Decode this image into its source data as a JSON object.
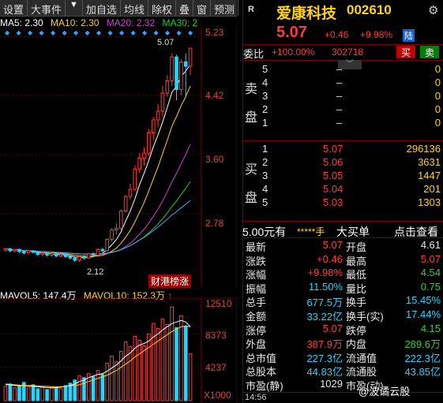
{
  "toolbar": {
    "items": [
      "设置",
      "大事件",
      "▼",
      "加自选",
      "均线",
      "除权",
      "叠",
      "窗",
      "预测"
    ]
  },
  "ma_legend": {
    "ma5": "MA5: 2.30",
    "ma10": "MA10: 2.30",
    "ma20": "MA20: 2.32",
    "ma30": "MA30: 2"
  },
  "price_axis": [
    "5.23",
    "4.42",
    "3.60",
    "2.78"
  ],
  "high_label": "5.07",
  "low_label": "2.12",
  "tag_label": "财港榜涨",
  "volume_legend": {
    "mavol5": "MAVOL5: 147.4万",
    "mavol10": "MAVOL10: 152.3万"
  },
  "volume_axis": [
    "12510",
    "8373",
    "4237",
    "X1000"
  ],
  "chart_data": {
    "type": "candlestick",
    "ylim": [
      1.9,
      5.3
    ],
    "candles": [
      [
        2.28,
        2.3,
        2.26,
        2.31
      ],
      [
        2.3,
        2.27,
        2.25,
        2.31
      ],
      [
        2.27,
        2.29,
        2.25,
        2.3
      ],
      [
        2.29,
        2.26,
        2.24,
        2.3
      ],
      [
        2.26,
        2.24,
        2.22,
        2.28
      ],
      [
        2.24,
        2.27,
        2.23,
        2.28
      ],
      [
        2.27,
        2.25,
        2.23,
        2.28
      ],
      [
        2.25,
        2.22,
        2.2,
        2.26
      ],
      [
        2.22,
        2.24,
        2.2,
        2.25
      ],
      [
        2.24,
        2.21,
        2.19,
        2.25
      ],
      [
        2.21,
        2.23,
        2.19,
        2.24
      ],
      [
        2.23,
        2.2,
        2.18,
        2.24
      ],
      [
        2.2,
        2.22,
        2.18,
        2.23
      ],
      [
        2.22,
        2.19,
        2.17,
        2.23
      ],
      [
        2.19,
        2.17,
        2.15,
        2.2
      ],
      [
        2.17,
        2.14,
        2.12,
        2.18
      ],
      [
        2.14,
        2.19,
        2.12,
        2.2
      ],
      [
        2.19,
        2.17,
        2.15,
        2.21
      ],
      [
        2.17,
        2.23,
        2.16,
        2.24
      ],
      [
        2.23,
        2.21,
        2.19,
        2.25
      ],
      [
        2.21,
        2.29,
        2.2,
        2.3
      ],
      [
        2.29,
        2.27,
        2.25,
        2.31
      ],
      [
        2.27,
        2.43,
        2.26,
        2.44
      ],
      [
        2.43,
        2.56,
        2.4,
        2.58
      ],
      [
        2.56,
        2.58,
        2.5,
        2.65
      ],
      [
        2.58,
        2.82,
        2.56,
        2.84
      ],
      [
        2.82,
        3.02,
        2.8,
        3.05
      ],
      [
        3.02,
        3.12,
        2.98,
        3.2
      ],
      [
        3.12,
        3.4,
        3.1,
        3.45
      ],
      [
        3.4,
        3.55,
        3.35,
        3.62
      ],
      [
        3.55,
        3.62,
        3.45,
        3.7
      ],
      [
        3.62,
        3.9,
        3.58,
        3.95
      ],
      [
        3.9,
        4.08,
        3.8,
        4.12
      ],
      [
        4.08,
        4.2,
        3.98,
        4.3
      ],
      [
        4.2,
        4.45,
        4.12,
        4.55
      ],
      [
        4.45,
        4.62,
        4.4,
        4.7
      ],
      [
        4.62,
        4.95,
        4.55,
        5.0
      ],
      [
        4.95,
        4.5,
        4.35,
        4.98
      ],
      [
        4.5,
        4.88,
        4.42,
        4.92
      ],
      [
        4.88,
        4.82,
        4.4,
        5.0
      ],
      [
        4.82,
        5.07,
        4.7,
        5.07
      ]
    ],
    "volumes": [
      1800,
      2100,
      1600,
      1900,
      2300,
      1700,
      2000,
      1500,
      1800,
      1400,
      1700,
      1600,
      1500,
      1900,
      2200,
      2600,
      3100,
      2900,
      3400,
      3000,
      3800,
      3300,
      4700,
      5600,
      4900,
      6200,
      7400,
      6800,
      8100,
      7600,
      6900,
      8400,
      9700,
      9100,
      10300,
      9600,
      11800,
      9200,
      10700,
      9400,
      5900
    ],
    "mavol5": [
      2000,
      2000,
      1900,
      1900,
      1900,
      1850,
      1800,
      1750,
      1700,
      1650,
      1600,
      1650,
      1700,
      1800,
      1900,
      2100,
      2400,
      2600,
      2900,
      3100,
      3300,
      3400,
      3700,
      4100,
      4500,
      5000,
      5600,
      6000,
      6600,
      7000,
      7200,
      7500,
      8000,
      8400,
      8900,
      9300,
      9700,
      9900,
      10100,
      9900,
      9300
    ],
    "mavol10": [
      2100,
      2050,
      2000,
      1950,
      1950,
      1900,
      1900,
      1850,
      1800,
      1800,
      1750,
      1750,
      1750,
      1800,
      1850,
      1900,
      2000,
      2200,
      2400,
      2600,
      2800,
      3000,
      3200,
      3500,
      3800,
      4200,
      4600,
      5000,
      5500,
      5900,
      6300,
      6700,
      7100,
      7500,
      7900,
      8300,
      8700,
      9000,
      9300,
      9400,
      9300
    ]
  },
  "stock": {
    "market": "R",
    "name": "爱康科技",
    "code": "002610",
    "price": "5.07",
    "change": "+0.46",
    "pct": "+9.98%",
    "tag": "陆",
    "weibi_label": "委比",
    "weibi": "+100.00%",
    "weicha": "302718",
    "buy_btn": "买",
    "sell_btn": "卖"
  },
  "sell_orders": {
    "side_label": [
      "卖",
      "盘"
    ],
    "rows": [
      {
        "level": "5",
        "price": "–",
        "vol": "0"
      },
      {
        "level": "4",
        "price": "–",
        "vol": "0"
      },
      {
        "level": "3",
        "price": "–",
        "vol": "0"
      },
      {
        "level": "2",
        "price": "–",
        "vol": "0"
      },
      {
        "level": "1",
        "price": "–",
        "vol": "0"
      }
    ]
  },
  "buy_orders": {
    "side_label": [
      "买",
      "盘"
    ],
    "rows": [
      {
        "level": "1",
        "price": "5.07",
        "vol": "296136"
      },
      {
        "level": "2",
        "price": "5.06",
        "vol": "3631"
      },
      {
        "level": "3",
        "price": "5.05",
        "vol": "1447"
      },
      {
        "level": "4",
        "price": "5.04",
        "vol": "201"
      },
      {
        "level": "5",
        "price": "5.03",
        "vol": "1303"
      }
    ]
  },
  "big_order": {
    "price": "5.00元有",
    "stars": "*****手",
    "label": "大买单",
    "link": "点击查看"
  },
  "stats": [
    {
      "l1": "最新",
      "v1": "5.07",
      "c1": "red",
      "l2": "开盘",
      "v2": "4.61",
      "c2": "white"
    },
    {
      "l1": "涨跌",
      "v1": "+0.46",
      "c1": "red",
      "l2": "最高",
      "v2": "5.07",
      "c2": "red"
    },
    {
      "l1": "涨幅",
      "v1": "+9.98%",
      "c1": "red",
      "l2": "最低",
      "v2": "4.54",
      "c2": "green"
    },
    {
      "l1": "振幅",
      "v1": "11.50%",
      "c1": "cyan",
      "l2": "量比",
      "v2": "0.75",
      "c2": "green"
    },
    {
      "l1": "总手",
      "v1": "677.5万",
      "c1": "cyan",
      "l2": "换手",
      "v2": "15.45%",
      "c2": "cyan"
    },
    {
      "l1": "金额",
      "v1": "33.22亿",
      "c1": "cyan",
      "l2": "换手(实)",
      "v2": "17.44%",
      "c2": "cyan"
    },
    {
      "l1": "涨停",
      "v1": "5.07",
      "c1": "red",
      "l2": "跌停",
      "v2": "4.15",
      "c2": "green"
    },
    {
      "l1": "外盘",
      "v1": "387.9万",
      "c1": "red",
      "l2": "内盘",
      "v2": "289.6万",
      "c2": "green"
    },
    {
      "l1": "总市值",
      "v1": "227.3亿",
      "c1": "cyan",
      "l2": "流通值",
      "v2": "222.3亿",
      "c2": "cyan"
    },
    {
      "l1": "总股本",
      "v1": "44.83亿",
      "c1": "cyan",
      "l2": "流通股",
      "v2": "43.85亿",
      "c2": "cyan"
    },
    {
      "l1": "市盈(静)",
      "v1": "1029",
      "c1": "white",
      "l2": "市盈(动)",
      "v2": "",
      "c2": "white"
    }
  ],
  "footer": {
    "time": "14:56",
    "watermark": "@波谲云股"
  },
  "colors": {
    "up": "#ff3b3b",
    "down": "#24d6ff",
    "ma5": "#ffffff",
    "ma10": "#ffd21a",
    "ma20": "#d040d0",
    "ma30": "#20d020",
    "ma60": "#4aa0ff"
  }
}
